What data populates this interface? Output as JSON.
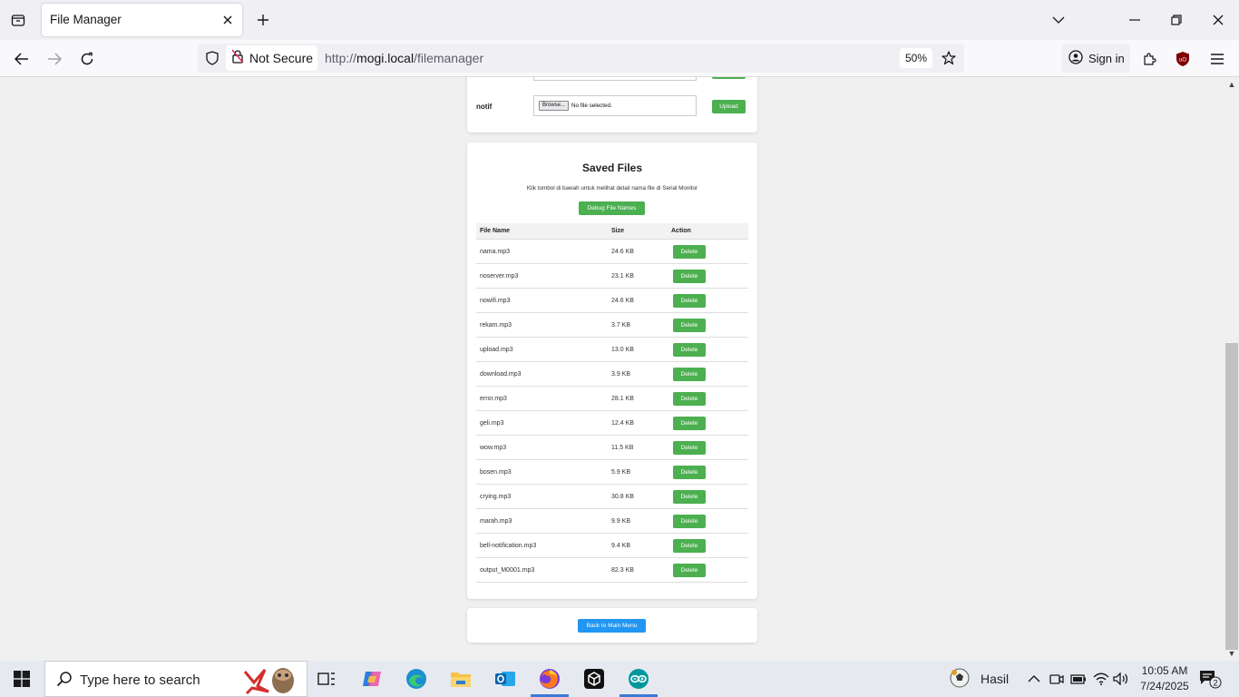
{
  "browser": {
    "tab_title": "File Manager",
    "security_label": "Not Secure",
    "url_prefix": "http://",
    "url_host": "mogi.local",
    "url_path": "/filemanager",
    "zoom": "50%",
    "signin_label": "Sign in"
  },
  "upload_section": {
    "notif_label": "notif",
    "browse_label": "Browse...",
    "no_file_text": "No file selected.",
    "upload_label": "Upload"
  },
  "saved_files": {
    "title": "Saved Files",
    "hint": "Klik tombol di bawah untuk melihat detail nama file di Serial Monitor",
    "debug_button": "Debug File Names",
    "columns": [
      "File Name",
      "Size",
      "Action"
    ],
    "rows": [
      {
        "name": "nama.mp3",
        "size": "24.6 KB",
        "action": "Delete"
      },
      {
        "name": "noserver.mp3",
        "size": "23.1 KB",
        "action": "Delete"
      },
      {
        "name": "nowifi.mp3",
        "size": "24.6 KB",
        "action": "Delete"
      },
      {
        "name": "rekam.mp3",
        "size": "3.7 KB",
        "action": "Delete"
      },
      {
        "name": "upload.mp3",
        "size": "13.0 KB",
        "action": "Delete"
      },
      {
        "name": "download.mp3",
        "size": "3.9 KB",
        "action": "Delete"
      },
      {
        "name": "error.mp3",
        "size": "28.1 KB",
        "action": "Delete"
      },
      {
        "name": "geli.mp3",
        "size": "12.4 KB",
        "action": "Delete"
      },
      {
        "name": "wow.mp3",
        "size": "11.5 KB",
        "action": "Delete"
      },
      {
        "name": "bosen.mp3",
        "size": "5.9 KB",
        "action": "Delete"
      },
      {
        "name": "crying.mp3",
        "size": "30.8 KB",
        "action": "Delete"
      },
      {
        "name": "marah.mp3",
        "size": "9.9 KB",
        "action": "Delete"
      },
      {
        "name": "bell-notification.mp3",
        "size": "9.4 KB",
        "action": "Delete"
      },
      {
        "name": "output_M0001.mp3",
        "size": "82.3 KB",
        "action": "Delete"
      }
    ]
  },
  "back_button": "Back to Main Menu",
  "taskbar": {
    "search_placeholder": "Type here to search",
    "weather_label": "Hasil",
    "time": "10:05 AM",
    "date": "7/24/2025",
    "notification_count": "2"
  },
  "colors": {
    "primary_green": "#4caf50",
    "primary_blue": "#2196f3"
  }
}
